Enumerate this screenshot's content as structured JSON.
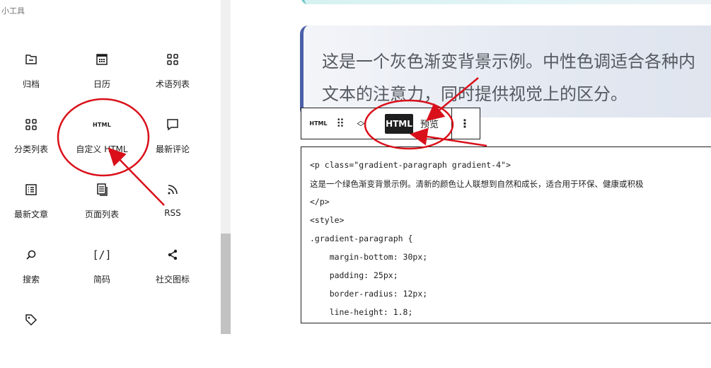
{
  "sidebar": {
    "section_title": "小工具",
    "blocks": [
      {
        "label": "归档",
        "icon": "archive-icon"
      },
      {
        "label": "日历",
        "icon": "calendar-icon"
      },
      {
        "label": "术语列表",
        "icon": "grid-icon"
      },
      {
        "label": "分类列表",
        "icon": "grid-icon"
      },
      {
        "label": "自定义 HTML",
        "icon": "html-icon",
        "icon_text": "HTML"
      },
      {
        "label": "最新评论",
        "icon": "comment-icon"
      },
      {
        "label": "最新文章",
        "icon": "list-icon"
      },
      {
        "label": "页面列表",
        "icon": "pages-icon"
      },
      {
        "label": "RSS",
        "icon": "rss-icon"
      },
      {
        "label": "搜索",
        "icon": "search-icon"
      },
      {
        "label": "简码",
        "icon": "shortcode-icon",
        "icon_text": "[/]"
      },
      {
        "label": "社交图标",
        "icon": "share-icon"
      },
      {
        "label": "",
        "icon": "tag-icon"
      }
    ]
  },
  "editor": {
    "gray_paragraph": {
      "line1": "这是一个灰色渐变背景示例。中性色调适合各种内",
      "line2": "文本的注意力，同时提供视觉上的区分。"
    },
    "toolbar": {
      "block_icon_text": "HTML",
      "html_tab": "HTML",
      "preview_tab": "预览"
    },
    "code_lines": [
      "<p class=\"gradient-paragraph gradient-4\">",
      "这是一个绿色渐变背景示例。清新的颜色让人联想到自然和成长，适合用于环保、健康或积极",
      "</p>",
      "<style>",
      ".gradient-paragraph {",
      "    margin-bottom: 30px;",
      "    padding: 25px;",
      "    border-radius: 12px;",
      "    line-height: 1.8;"
    ]
  },
  "colors": {
    "annotation": "#d9101a",
    "accent_border": "#4a60a8",
    "toolbar_active": "#1e1e1e"
  }
}
